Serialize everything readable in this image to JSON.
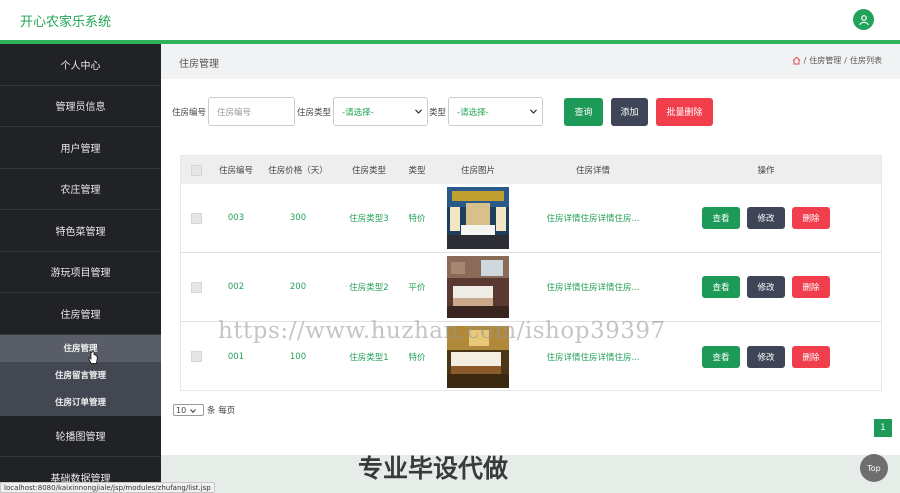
{
  "app": {
    "title": "开心农家乐系统"
  },
  "sidebar": {
    "items": [
      {
        "label": "个人中心"
      },
      {
        "label": "管理员信息"
      },
      {
        "label": "用户管理"
      },
      {
        "label": "农庄管理"
      },
      {
        "label": "特色菜管理"
      },
      {
        "label": "游玩项目管理"
      },
      {
        "label": "住房管理"
      }
    ],
    "subitems": [
      {
        "label": "住房管理",
        "active": true
      },
      {
        "label": "住房留言管理"
      },
      {
        "label": "住房订单管理"
      }
    ],
    "items_after": [
      {
        "label": "轮播图管理"
      },
      {
        "label": "基础数据管理"
      }
    ]
  },
  "header": {
    "page_title": "住房管理",
    "breadcrumb": [
      "住房管理",
      "住房列表"
    ],
    "breadcrumb_sep": "/"
  },
  "search": {
    "id_label": "住房编号",
    "id_placeholder": "住房编号",
    "type_label": "住房类型",
    "type_selected": "-请选择-",
    "kind_label": "类型",
    "kind_selected": "-请选择-",
    "query_button": "查询",
    "add_button": "添加",
    "batch_delete_button": "批量删除"
  },
  "table": {
    "columns": [
      "住房编号",
      "住房价格（天）",
      "住房类型",
      "类型",
      "住房图片",
      "住房详情",
      "操作"
    ],
    "rows": [
      {
        "id": "003",
        "price": "300",
        "type": "住房类型3",
        "kind": "特价",
        "detail": "住房详情住房详情住房...",
        "image": "room-photo-1"
      },
      {
        "id": "002",
        "price": "200",
        "type": "住房类型2",
        "kind": "平价",
        "detail": "住房详情住房详情住房...",
        "image": "room-photo-2"
      },
      {
        "id": "001",
        "price": "100",
        "type": "住房类型1",
        "kind": "特价",
        "detail": "住房详情住房详情住房...",
        "image": "room-photo-3"
      }
    ],
    "ops": {
      "view": "查看",
      "edit": "修改",
      "delete": "删除"
    }
  },
  "pagination": {
    "page_size": "10",
    "page_size_suffix": "条 每页",
    "current_page": "1"
  },
  "overlay": {
    "watermark": "https://www.huzhan.com/ishop39397",
    "promo": "专业毕设代做",
    "top_button": "Top",
    "status_url": "localhost:8080/kaixinnongjiale/jsp/modules/zhufang/list.jsp"
  },
  "colors": {
    "accent": "#21a656",
    "sidebar": "#202225",
    "danger": "#f03e4d",
    "dark": "#3d4556"
  }
}
